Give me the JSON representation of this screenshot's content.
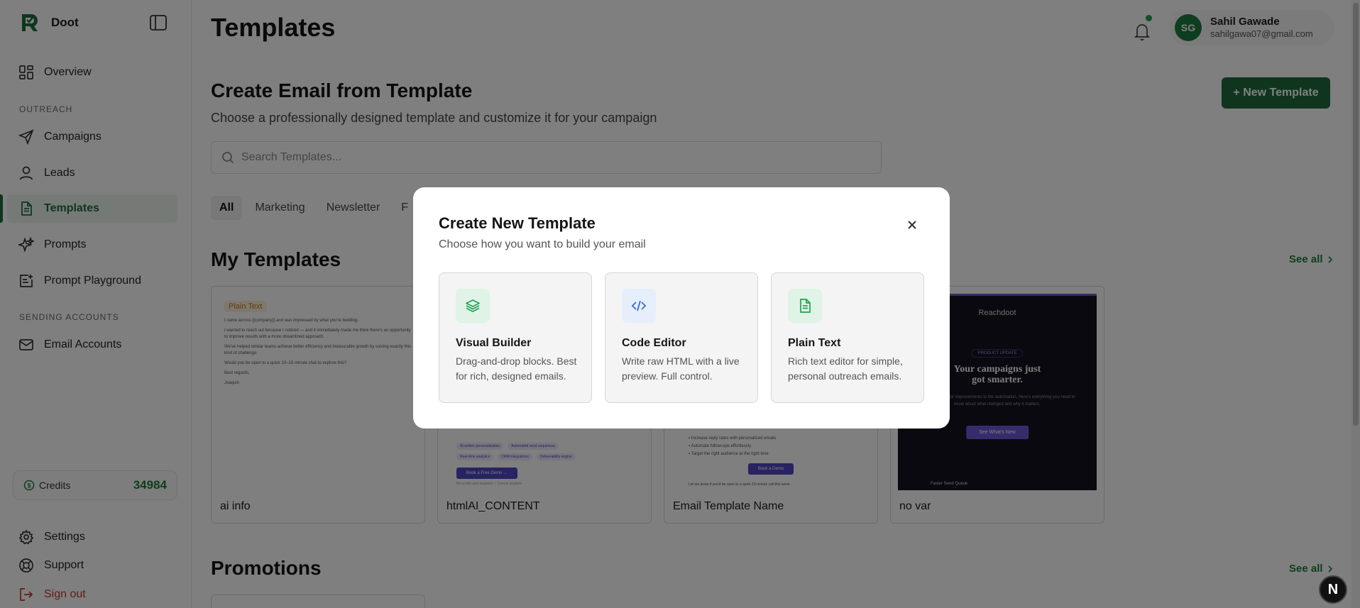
{
  "brand": {
    "name": "Doot"
  },
  "sidebar": {
    "items": [
      {
        "label": "Overview"
      },
      {
        "label": "Campaigns"
      },
      {
        "label": "Leads"
      },
      {
        "label": "Templates"
      },
      {
        "label": "Prompts"
      },
      {
        "label": "Prompt Playground"
      },
      {
        "label": "Email Accounts"
      },
      {
        "label": "Settings"
      },
      {
        "label": "Support"
      },
      {
        "label": "Sign out"
      }
    ],
    "sections": {
      "outreach": "OUTREACH",
      "sending": "SENDING ACCOUNTS"
    },
    "credits": {
      "label": "Credits",
      "value": "34984"
    }
  },
  "header": {
    "title": "Templates",
    "user": {
      "initials": "SG",
      "name": "Sahil Gawade",
      "email": "sahilgawa07@gmail.com"
    }
  },
  "main": {
    "heading": "Create Email from Template",
    "subheading": "Choose a professionally designed template and customize it for your campaign",
    "new_template_label": "+ New Template",
    "search": {
      "placeholder": "Search Templates..."
    },
    "tabs": [
      "All",
      "Marketing",
      "Newsletter",
      "F"
    ],
    "my_templates_title": "My Templates",
    "see_all": "See all",
    "promotions_title": "Promotions",
    "cards": [
      {
        "label": "ai info",
        "badge": "Plain Text",
        "lines": [
          "I came across {{company}} and was impressed by what you're building.",
          "I wanted to reach out because I noticed — and it immediately made me think there's an opportunity to improve results with a more streamlined approach.",
          "We've helped similar teams achieve better efficiency and measurable growth by solving exactly this kind of challenge.",
          "Would you be open to a quick 10–15 minute chat to explore this?",
          "Best regards,",
          "Joaquin"
        ]
      },
      {
        "label": "htmlAI_CONTENT",
        "chips_1": [
          "AI-written personalization",
          "Automated send sequences"
        ],
        "chips_2": [
          "Real-time analytics",
          "CRM integrations",
          "Deliverability engine"
        ],
        "button": "Book a Free Demo →",
        "foot": "No credit card required   ✓ Cancel anytime"
      },
      {
        "label": "Email Template Name",
        "bullets": [
          "Increase reply rates with personalized emails",
          "Automate follow-ups effortlessly",
          "Target the right audience at the right time"
        ],
        "button": "Book a Demo",
        "foot": "Let me know if you'd be open to a quick 15-minute call this week."
      },
      {
        "label": "no var",
        "brand": "Reachdoot",
        "chip": "PRODUCT UPDATE",
        "headline_1": "Your campaigns just",
        "headline_2": "got smarter.",
        "body": "ed out three major improvements to the automation. Here's everything you need to know about what changed and why it matters.",
        "button": "See What's New",
        "foot": "Faster Send Queue"
      }
    ]
  },
  "modal": {
    "title": "Create New Template",
    "subtitle": "Choose how you want to build your email",
    "options": [
      {
        "title": "Visual Builder",
        "desc": "Drag-and-drop blocks. Best for rich, designed emails.",
        "icon": "layers-icon",
        "color": "#22a150"
      },
      {
        "title": "Code Editor",
        "desc": "Write raw HTML with a live preview. Full control.",
        "icon": "code-icon",
        "color": "#2f6fd6"
      },
      {
        "title": "Plain Text",
        "desc": "Rich text editor for simple, personal outreach emails.",
        "icon": "document-icon",
        "color": "#22a150"
      }
    ]
  },
  "dev_badge": "N",
  "colors": {
    "accent": "#1f6b3c",
    "credits": "#1f7a3f"
  }
}
